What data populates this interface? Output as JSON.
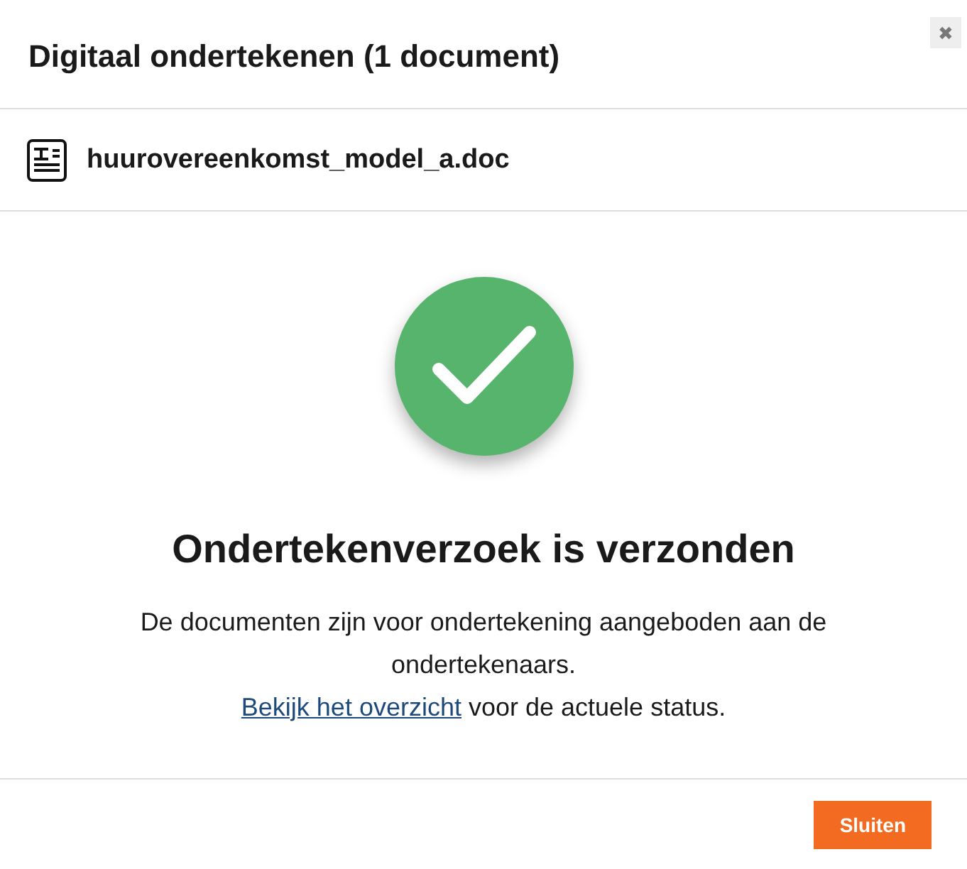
{
  "dialog": {
    "title": "Digitaal ondertekenen (1 document)",
    "close": "✖"
  },
  "document": {
    "name": "huurovereenkomst_model_a.doc"
  },
  "result": {
    "heading": "Ondertekenverzoek is verzonden",
    "message": "De documenten zijn voor ondertekening aangeboden aan de ondertekenaars.",
    "link": "Bekijk het overzicht",
    "after_link": " voor de actuele status."
  },
  "buttons": [
    "Sluiten"
  ]
}
